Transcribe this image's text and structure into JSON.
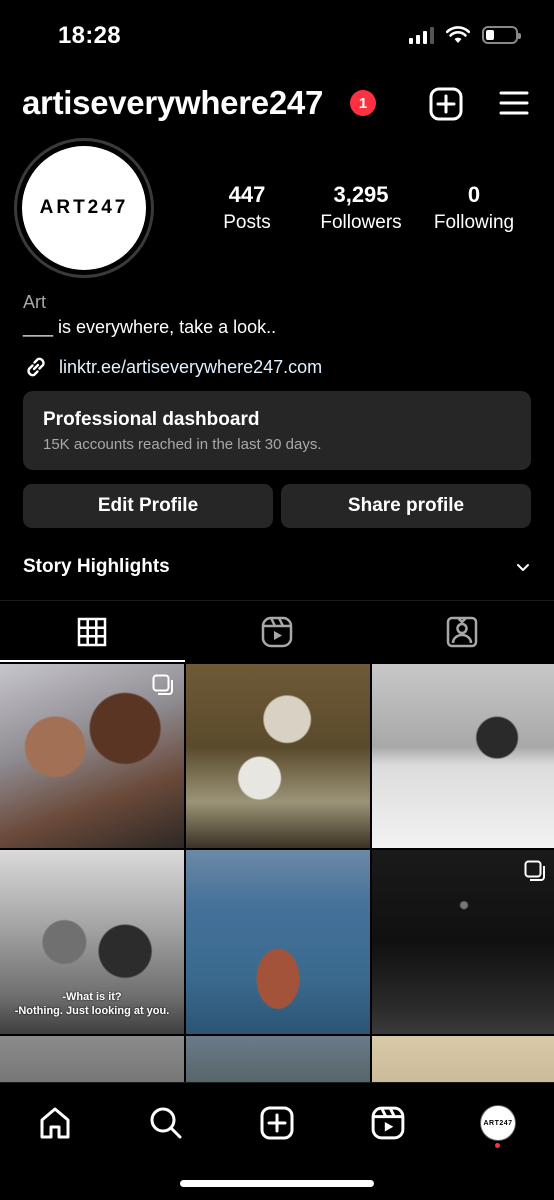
{
  "status_bar": {
    "time": "18:28",
    "icons": [
      "cellular-signal-icon",
      "wifi-icon",
      "battery-icon"
    ]
  },
  "header": {
    "username": "artiseverywhere247",
    "notification_count": "1",
    "icons": [
      "add-post-icon",
      "menu-icon"
    ]
  },
  "profile": {
    "avatar_text": "ART247",
    "stats": {
      "posts": {
        "value": "447",
        "label": "Posts"
      },
      "followers": {
        "value": "3,295",
        "label": "Followers"
      },
      "following": {
        "value": "0",
        "label": "Following"
      }
    },
    "bio_name": "Art",
    "bio_text": "___ is everywhere, take a look..",
    "link": "linktr.ee/artiseverywhere247.com"
  },
  "dashboard": {
    "title": "Professional dashboard",
    "subtitle": "15K accounts reached in the last 30 days."
  },
  "buttons": {
    "edit_profile": "Edit Profile",
    "share_profile": "Share profile"
  },
  "highlights": {
    "title": "Story Highlights"
  },
  "tabs": {
    "items": [
      "grid-icon",
      "reels-icon",
      "tagged-icon"
    ],
    "active": "grid-icon"
  },
  "posts": {
    "p4_caption_line1": "-What is it?",
    "p4_caption_line2": "-Nothing. Just looking at you.",
    "multi_image_posts": [
      1,
      6
    ]
  },
  "bottom_nav": {
    "items": [
      "home-icon",
      "search-icon",
      "create-icon",
      "reels-icon",
      "profile-avatar"
    ],
    "avatar_text": "ART247"
  },
  "colors": {
    "background": "#000000",
    "surface": "#262626",
    "badge": "#ff3040",
    "secondary_text": "#a8a8a8"
  }
}
